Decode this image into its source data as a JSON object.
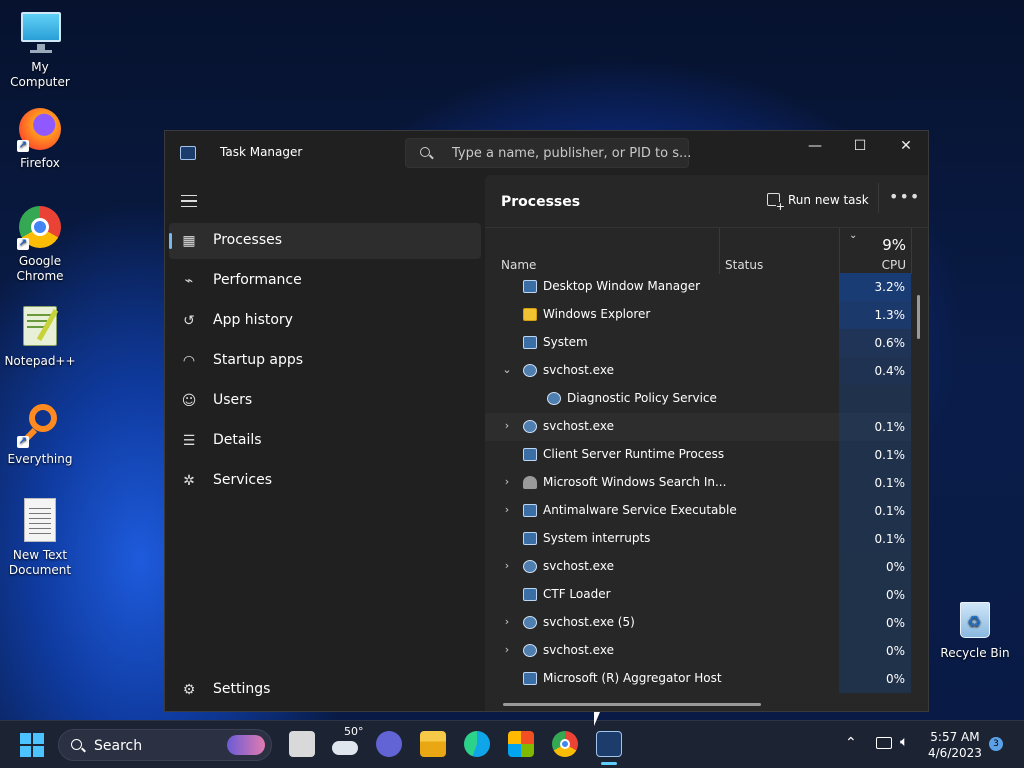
{
  "desktop": {
    "icons": [
      {
        "label": "My Computer",
        "icon": "monitor-icon"
      },
      {
        "label": "Firefox",
        "icon": "firefox-icon"
      },
      {
        "label": "Google Chrome",
        "icon": "chrome-icon"
      },
      {
        "label": "Notepad++",
        "icon": "notepadpp-icon"
      },
      {
        "label": "Everything",
        "icon": "everything-search-icon"
      },
      {
        "label": "New Text Document",
        "icon": "text-document-icon"
      },
      {
        "label": "Recycle Bin",
        "icon": "recycle-bin-icon"
      }
    ]
  },
  "window": {
    "title": "Task Manager",
    "search_placeholder": "Type a name, publisher, or PID to s...",
    "minimize": "—",
    "maximize": "☐",
    "close": "✕"
  },
  "nav": {
    "items": [
      {
        "label": "Processes",
        "icon": "processes-grid-icon",
        "glyph": "▦"
      },
      {
        "label": "Performance",
        "icon": "performance-chart-icon",
        "glyph": "⌁"
      },
      {
        "label": "App history",
        "icon": "history-clock-icon",
        "glyph": "↺"
      },
      {
        "label": "Startup apps",
        "icon": "startup-gauge-icon",
        "glyph": "◠"
      },
      {
        "label": "Users",
        "icon": "users-icon",
        "glyph": "☺"
      },
      {
        "label": "Details",
        "icon": "details-list-icon",
        "glyph": "☰"
      },
      {
        "label": "Services",
        "icon": "services-puzzle-icon",
        "glyph": "✲"
      }
    ],
    "settings_label": "Settings"
  },
  "processes": {
    "title": "Processes",
    "run_new_task": "Run new task",
    "more": "•••",
    "columns": {
      "name": "Name",
      "status": "Status",
      "cpu_percent": "9%",
      "cpu": "CPU"
    },
    "rows": [
      {
        "name": "Desktop Window Manager",
        "cpu": "3.2%",
        "expand": "",
        "icon": "app-window-icon",
        "cpu_heat": 0.5,
        "indent": 0
      },
      {
        "name": "Windows Explorer",
        "cpu": "1.3%",
        "expand": "",
        "icon": "folder-icon",
        "cpu_heat": 0.4,
        "indent": 0
      },
      {
        "name": "System",
        "cpu": "0.6%",
        "expand": "",
        "icon": "app-window-icon",
        "cpu_heat": 0.2,
        "indent": 0
      },
      {
        "name": "svchost.exe",
        "cpu": "0.4%",
        "expand": "⌄",
        "icon": "service-gear-icon",
        "cpu_heat": 0.15,
        "indent": 0
      },
      {
        "name": "Diagnostic Policy Service",
        "cpu": "",
        "expand": "",
        "icon": "gear-icon",
        "cpu_heat": 0.1,
        "indent": 1
      },
      {
        "name": "svchost.exe",
        "cpu": "0.1%",
        "expand": "›",
        "icon": "service-gear-icon",
        "cpu_heat": 0.1,
        "indent": 0
      },
      {
        "name": "Client Server Runtime Process",
        "cpu": "0.1%",
        "expand": "",
        "icon": "app-window-icon",
        "cpu_heat": 0.1,
        "indent": 0
      },
      {
        "name": "Microsoft Windows Search In...",
        "cpu": "0.1%",
        "expand": "›",
        "icon": "search-user-icon",
        "cpu_heat": 0.1,
        "indent": 0
      },
      {
        "name": "Antimalware Service Executable",
        "cpu": "0.1%",
        "expand": "›",
        "icon": "app-window-icon",
        "cpu_heat": 0.1,
        "indent": 0
      },
      {
        "name": "System interrupts",
        "cpu": "0.1%",
        "expand": "",
        "icon": "app-window-icon",
        "cpu_heat": 0.1,
        "indent": 0
      },
      {
        "name": "svchost.exe",
        "cpu": "0%",
        "expand": "›",
        "icon": "service-gear-icon",
        "cpu_heat": 0.08,
        "indent": 0
      },
      {
        "name": "CTF Loader",
        "cpu": "0%",
        "expand": "",
        "icon": "app-window-icon",
        "cpu_heat": 0.08,
        "indent": 0
      },
      {
        "name": "svchost.exe (5)",
        "cpu": "0%",
        "expand": "›",
        "icon": "service-gear-icon",
        "cpu_heat": 0.08,
        "indent": 0
      },
      {
        "name": "svchost.exe",
        "cpu": "0%",
        "expand": "›",
        "icon": "service-gear-icon",
        "cpu_heat": 0.08,
        "indent": 0
      },
      {
        "name": "Microsoft (R) Aggregator Host",
        "cpu": "0%",
        "expand": "",
        "icon": "app-window-icon",
        "cpu_heat": 0.08,
        "indent": 0
      }
    ]
  },
  "taskbar": {
    "search_label": "Search",
    "weather_temp": "50°",
    "time": "5:57 AM",
    "date": "4/6/2023",
    "notification_count": "3",
    "apps": [
      "start-icon",
      "task-view-icon",
      "weather-icon",
      "teams-chat-icon",
      "file-explorer-icon",
      "edge-icon",
      "store-icon",
      "chrome-icon",
      "task-manager-icon"
    ],
    "tray": [
      "chevron-up-icon",
      "network-icon",
      "volume-icon"
    ]
  }
}
